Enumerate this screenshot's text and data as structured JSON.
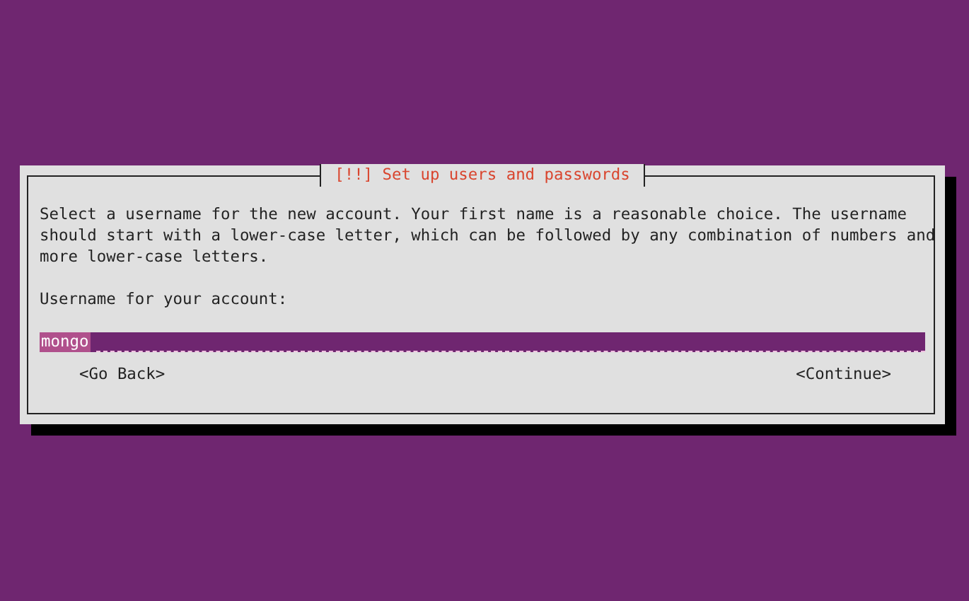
{
  "dialog": {
    "title": "[!!] Set up users and passwords",
    "description": "Select a username for the new account. Your first name is a reasonable choice. The username should start with a lower-case letter, which can be followed by any combination of numbers and more lower-case letters.",
    "field_label": "Username for your account:",
    "field_value": "mongo",
    "buttons": [
      {
        "label": "<Go Back>",
        "selected": false
      },
      {
        "label": "<Continue>",
        "selected": false
      }
    ]
  }
}
